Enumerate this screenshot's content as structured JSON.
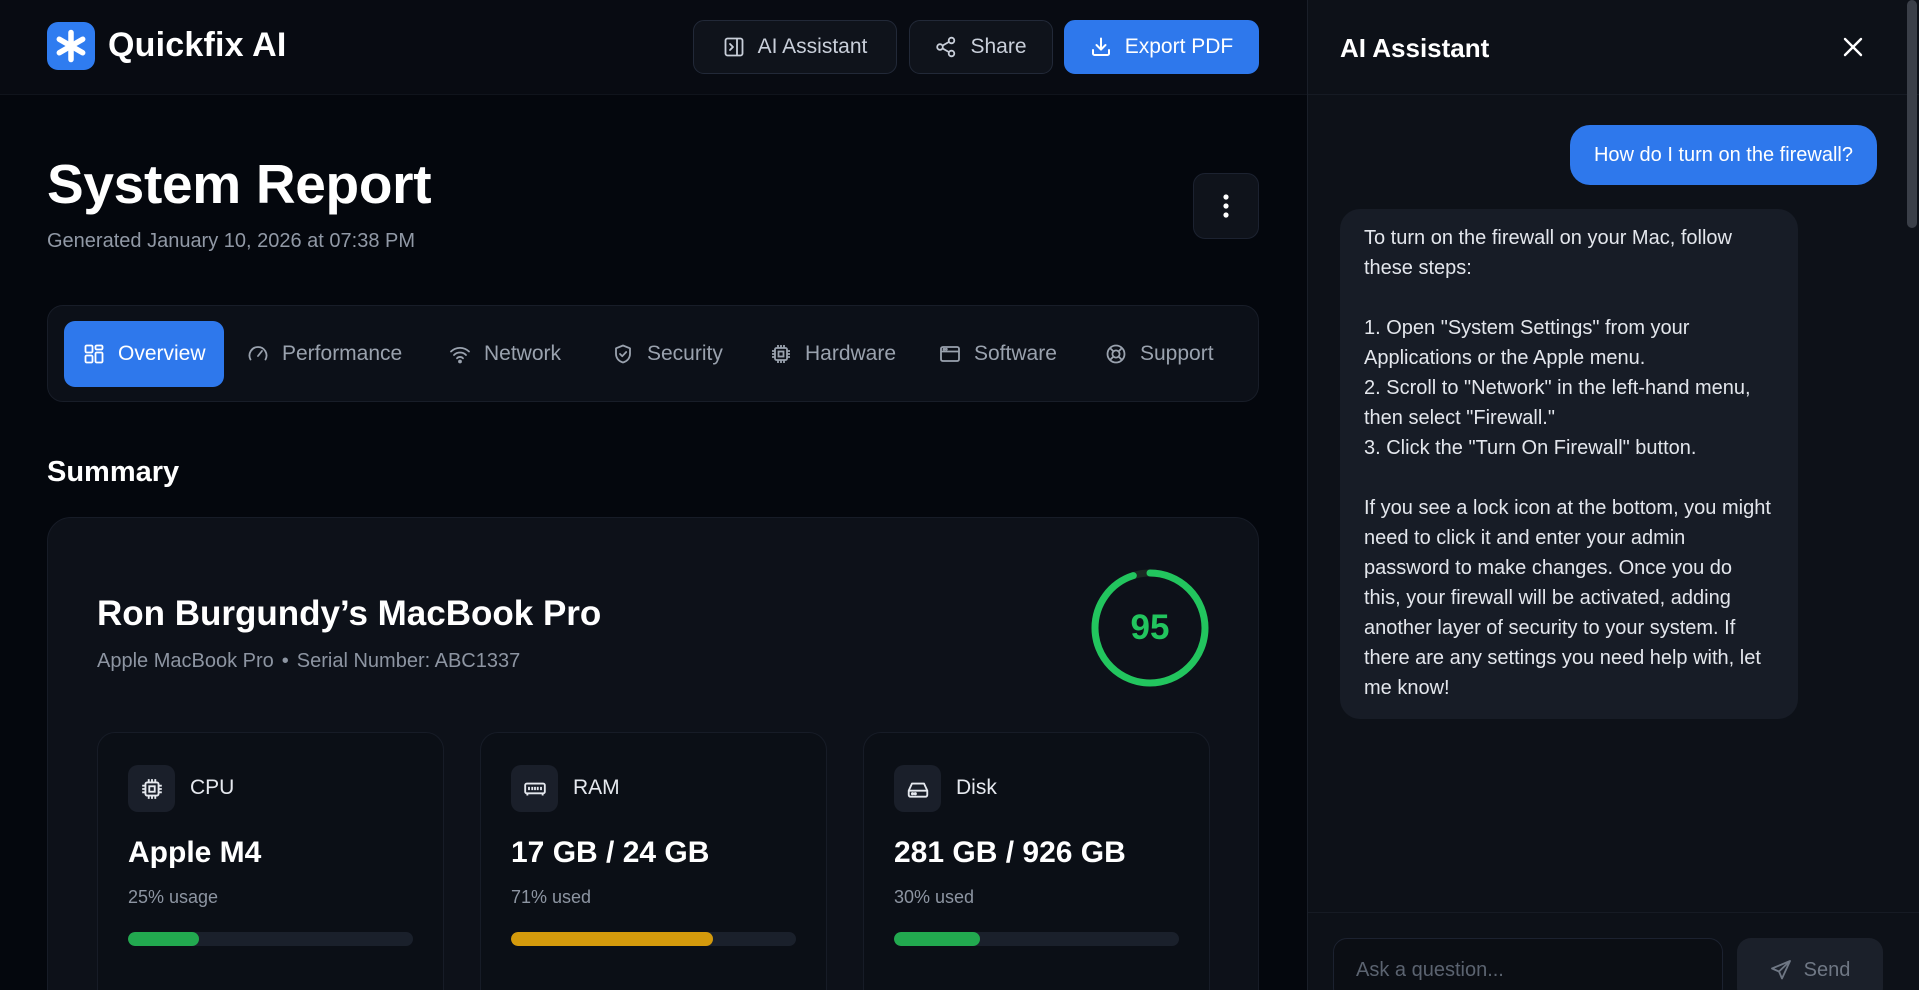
{
  "app": {
    "name": "Quickfix AI",
    "logo_icon": "asterisk-icon",
    "accent": "#2e78ec"
  },
  "header": {
    "ai_assistant_label": "AI Assistant",
    "share_label": "Share",
    "export_label": "Export PDF"
  },
  "report": {
    "title": "System Report",
    "generated": "Generated January 10, 2026 at 07:38 PM"
  },
  "tabs": [
    {
      "label": "Overview",
      "icon": "grid-icon",
      "active": true
    },
    {
      "label": "Performance",
      "icon": "gauge-icon"
    },
    {
      "label": "Network",
      "icon": "wifi-icon"
    },
    {
      "label": "Security",
      "icon": "shield-icon"
    },
    {
      "label": "Hardware",
      "icon": "chip-icon"
    },
    {
      "label": "Software",
      "icon": "window-icon"
    },
    {
      "label": "Support",
      "icon": "lifebuoy-icon"
    }
  ],
  "summary": {
    "heading": "Summary",
    "device_name": "Ron Burgundy’s MacBook Pro",
    "model": "Apple MacBook Pro",
    "separator": "•",
    "serial": "Serial Number: ABC1337",
    "score": "95",
    "score_fraction": 0.95,
    "score_color": "#22c55e",
    "stats": [
      {
        "label": "CPU",
        "icon": "cpu-icon",
        "value": "Apple M4",
        "sub": "25% usage",
        "percent": 25,
        "color": "#22a94f"
      },
      {
        "label": "RAM",
        "icon": "memory-icon",
        "value": "17 GB / 24 GB",
        "sub": "71% used",
        "percent": 71,
        "color": "#d49a0c"
      },
      {
        "label": "Disk",
        "icon": "disk-icon",
        "value": "281 GB / 926 GB",
        "sub": "30% used",
        "percent": 30,
        "color": "#22a94f"
      }
    ]
  },
  "assistant": {
    "title": "AI Assistant",
    "messages": [
      {
        "role": "user",
        "text": "How do I turn on the firewall?"
      },
      {
        "role": "assistant",
        "text": "To turn on the firewall on your Mac, follow these steps:\n\n1. Open \"System Settings\" from your Applications or the Apple menu.\n2. Scroll to \"Network\" in the left-hand menu, then select \"Firewall.\"\n3. Click the \"Turn On Firewall\" button.\n\nIf you see a lock icon at the bottom, you might need to click it and enter your admin password to make changes. Once you do this, your firewall will be activated, adding another layer of security to your system. If there are any settings you need help with, let me know!"
      }
    ],
    "input_placeholder": "Ask a question...",
    "send_label": "Send"
  }
}
